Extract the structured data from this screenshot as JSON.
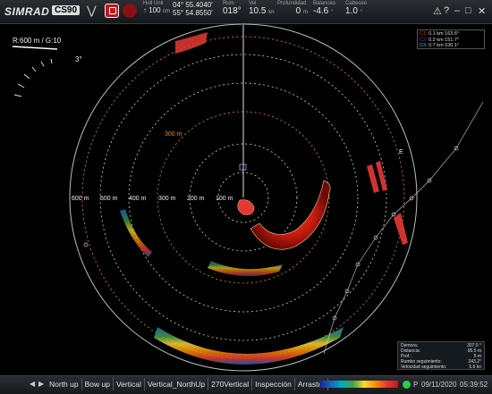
{
  "app": {
    "brand": "SIMRAD",
    "model": "CS90"
  },
  "header": {
    "hull_unit_label": "Hull Unit",
    "hull_unit_value": "100",
    "hull_unit_unit": "cm",
    "lat": "04° 55.4040'",
    "lon": "55° 54.8550'",
    "rumbo_label": "Rum",
    "rumbo_value": "018°",
    "vel_label": "Vel",
    "vel_value": "10.5",
    "vel_unit": "kn",
    "profundidad_label": "Profundidad",
    "profundidad_value": "0",
    "profundidad_unit": "m",
    "balanceo_label": "Balanceo",
    "balanceo_value": "-4.6",
    "balanceo_unit": "°",
    "cabeceo_label": "Cabeceo",
    "cabeceo_value": "1.0",
    "cabeceo_unit": "°"
  },
  "overlay": {
    "scale": "R:600 m / G:10",
    "tilt": "3°",
    "range_ring_label": "300 m",
    "range_labels": [
      "600 m",
      "500 m",
      "400 m",
      "300 m",
      "200 m",
      "100 m"
    ],
    "compass_e": "E"
  },
  "legend": {
    "rows": [
      {
        "id": "C1:",
        "dist": "0.1 km",
        "bearing": "163.6°",
        "color": "#e53935"
      },
      {
        "id": "C2:",
        "dist": "0.2 km",
        "bearing": "151.7°",
        "color": "#8e24aa"
      },
      {
        "id": "C3:",
        "dist": "0.7 km",
        "bearing": "030.1°",
        "color": "#26c6da"
      }
    ]
  },
  "info": {
    "rows": [
      {
        "label": "Demora:",
        "value": "307.5 °"
      },
      {
        "label": "Distancia:",
        "value": "95.5 m"
      },
      {
        "label": "Prof.:",
        "value": "5 m"
      },
      {
        "label": "Rumbo seguimiento:",
        "value": "343.2°"
      },
      {
        "label": "Velocidad seguimiento:",
        "value": "5.6 kn"
      }
    ]
  },
  "bottom": {
    "tabs": [
      "North up",
      "Bow up",
      "Vertical",
      "Vertical_NorthUp",
      "270Vertical",
      "Inspección",
      "Arrastre"
    ],
    "status_p": "P",
    "date": "09/11/2020",
    "time": "05:39:52"
  },
  "colors": {
    "ring": "#cfcfcf",
    "range_ring_orange": "#e58a2b",
    "accent_red": "#c4161c"
  }
}
